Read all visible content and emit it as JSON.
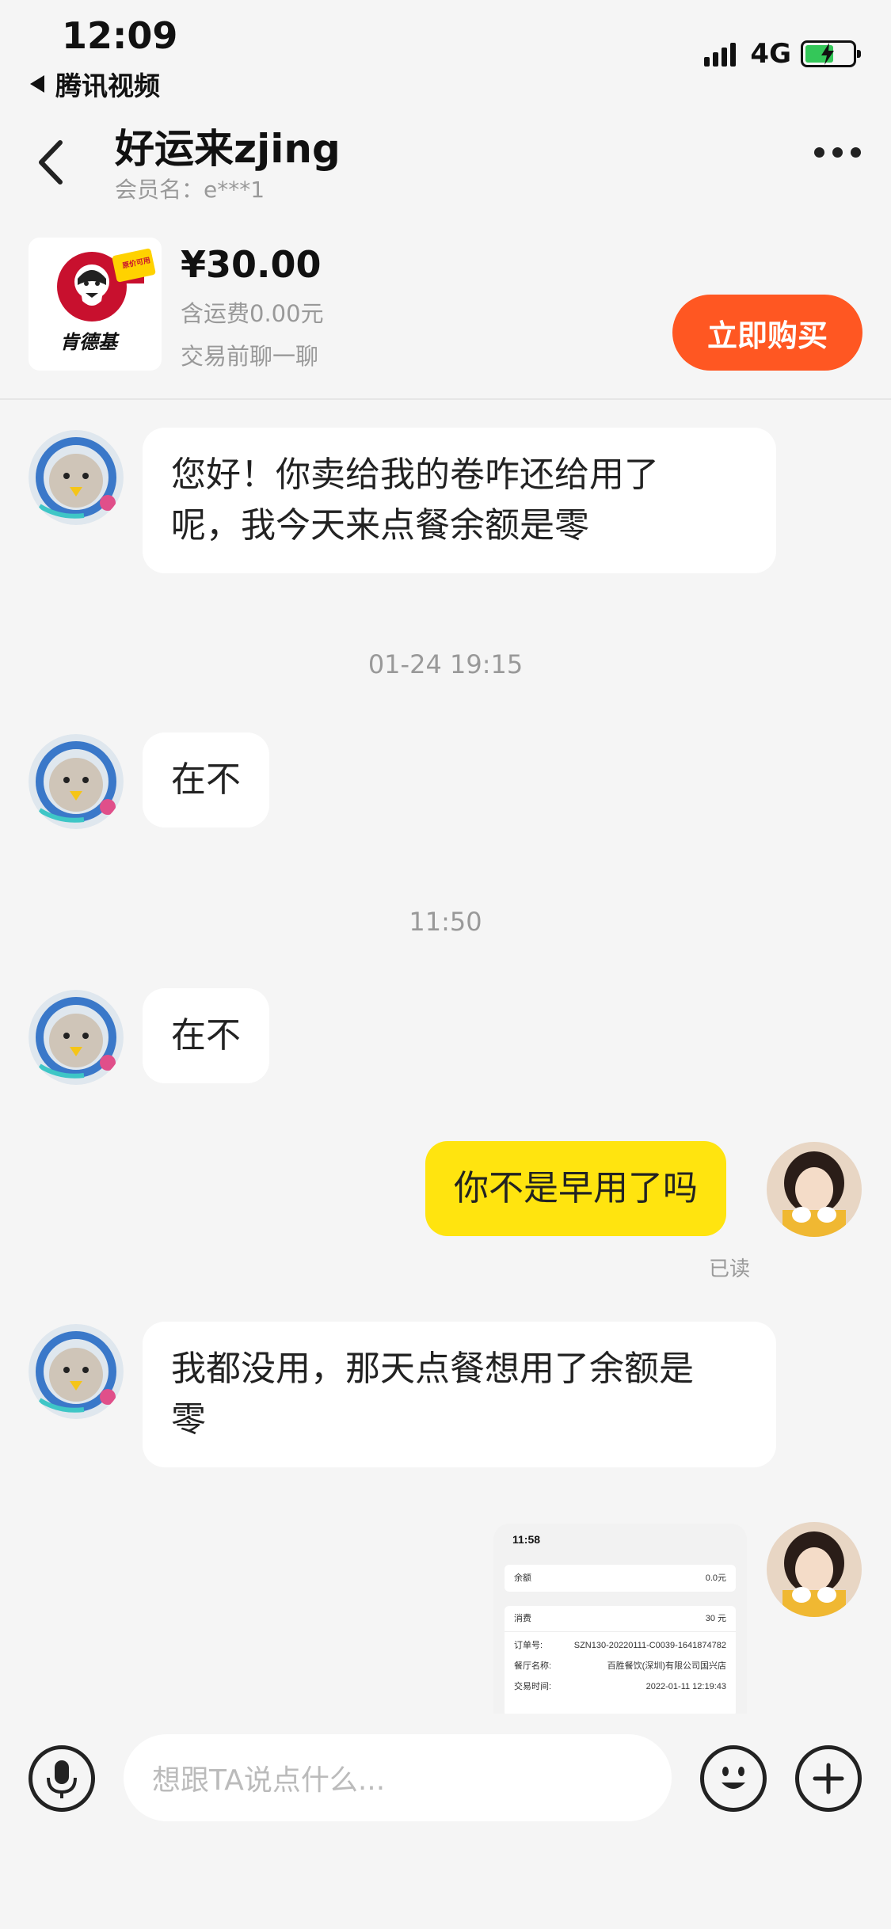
{
  "status_bar": {
    "time": "12:09",
    "back_app": "腾讯视频",
    "network": "4G"
  },
  "header": {
    "title": "好运来zjing",
    "member": "会员名：e***1"
  },
  "product": {
    "thumb_text": "肯德基",
    "thumb_badge": "原价可用",
    "price": "¥30.00",
    "shipping": "含运费0.00元",
    "chat_before": "交易前聊一聊",
    "buy_label": "立即购买"
  },
  "messages": [
    {
      "from": "seller",
      "text_line1": "您好！你卖给我的卷咋还给用了",
      "text_line2": "呢，我今天来点餐余额是零"
    },
    {
      "time": "01-24 19:15"
    },
    {
      "from": "seller",
      "text": "在不"
    },
    {
      "time": "11:50"
    },
    {
      "from": "seller",
      "text": "在不"
    },
    {
      "from": "me",
      "text": "你不是早用了吗",
      "status": "已读"
    },
    {
      "from": "seller",
      "text_line1": "我都没用，那天点餐想用了余额是",
      "text_line2": "零"
    },
    {
      "from": "me",
      "type": "image"
    }
  ],
  "image_message": {
    "time": "11:58",
    "balance_label": "余额",
    "balance_value": "0.0元",
    "spend_label": "消费",
    "spend_value": "30 元",
    "order_label": "订单号:",
    "order_value": "SZN130-20220111-C0039-1641874782",
    "store_label": "餐厅名称:",
    "store_value": "百胜餐饮(深圳)有限公司国兴店",
    "txtime_label": "交易时间:",
    "txtime_value": "2022-01-11 12:19:43"
  },
  "input": {
    "placeholder": "想跟TA说点什么..."
  },
  "colors": {
    "accent": "#ff5722",
    "my_bubble": "#ffe40f",
    "background": "#f5f5f5"
  }
}
